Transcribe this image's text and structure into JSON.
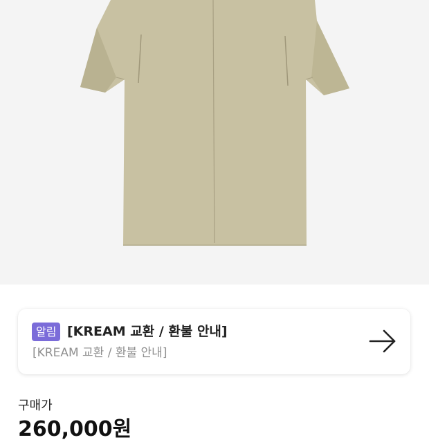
{
  "product": {
    "image_alt": "beige long coat",
    "coat_color": "#c8c1a2"
  },
  "notice": {
    "badge": "알림",
    "title": "[KREAM 교환 / 환불 안내]",
    "subtitle": "[KREAM 교환 / 환불 안내]",
    "badge_color": "#7b6cd9",
    "icon": "arrow-right-icon"
  },
  "price": {
    "label": "구매가",
    "value": "260,000원"
  }
}
